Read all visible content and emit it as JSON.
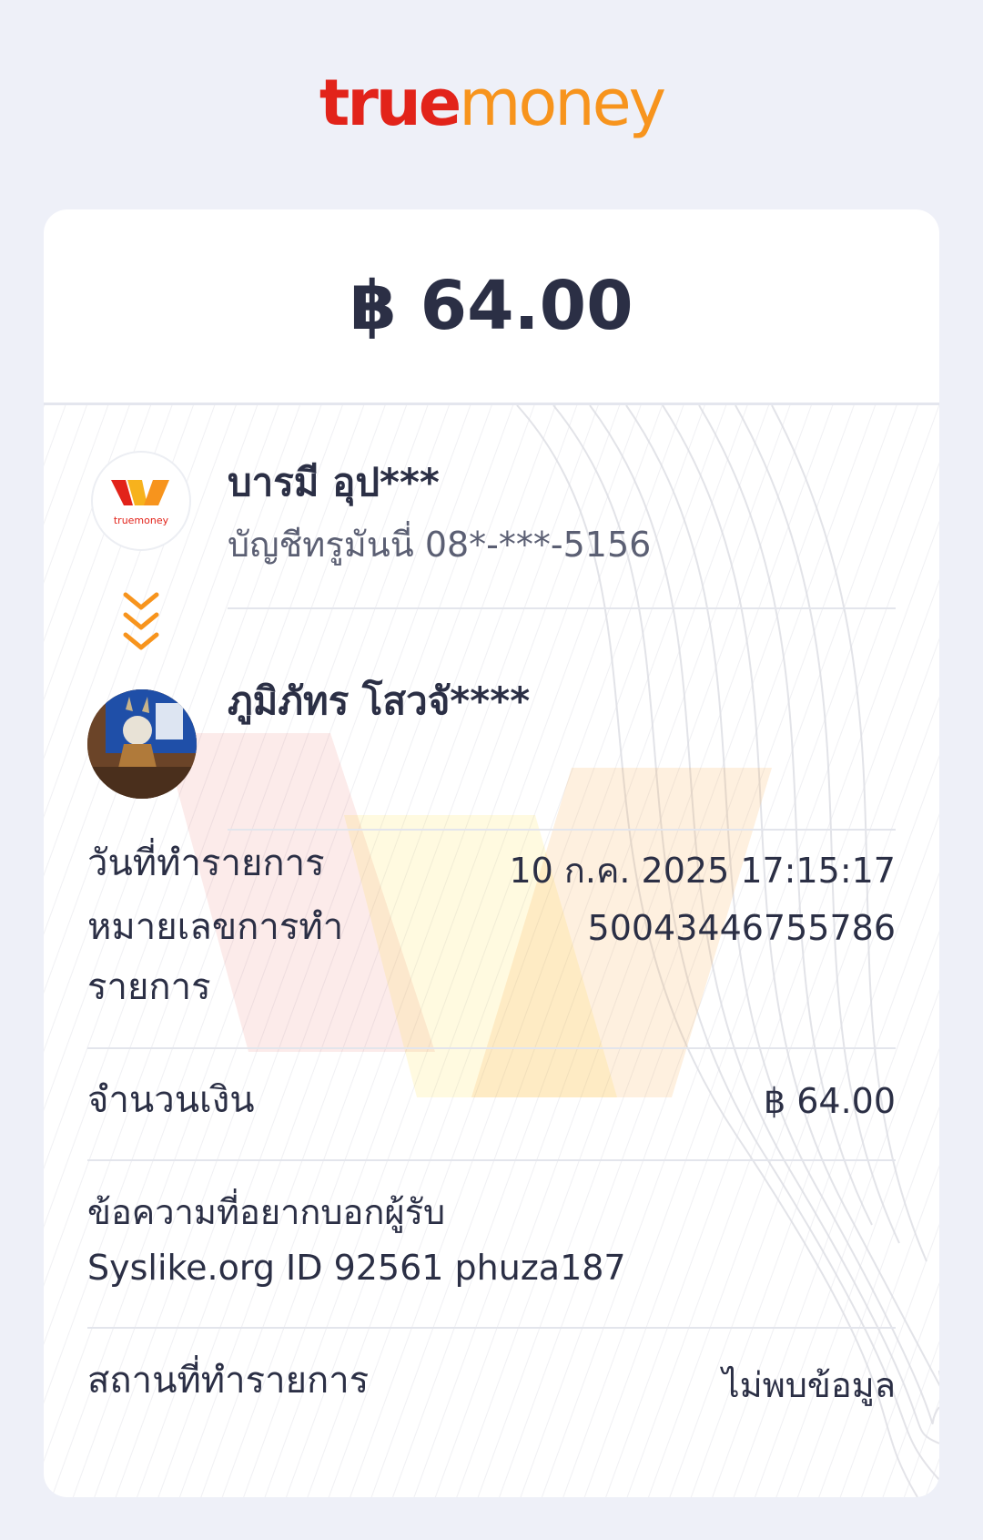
{
  "brand": {
    "part1": "true",
    "part2": "money",
    "icon_caption": "truemoney"
  },
  "amount_header": "฿ 64.00",
  "sender": {
    "name": "บารมี อุป***",
    "account": "บัญชีทรูมันนี่ 08*-***-5156"
  },
  "recipient": {
    "name": "ภูมิภัทร โสวจั****"
  },
  "details": {
    "date_label": "วันที่ทำรายการ",
    "date_value": "10 ก.ค. 2025 17:15:17",
    "txn_label": "หมายเลขการทำรายการ",
    "txn_value": "50043446755786",
    "amount_label": "จำนวนเงิน",
    "amount_value": "฿ 64.00",
    "message_label": "ข้อความที่อยากบอกผู้รับ",
    "message_value": "Syslike.org ID 92561 phuza187",
    "location_label": "สถานที่ทำรายการ",
    "location_value": "ไม่พบข้อมูล"
  },
  "colors": {
    "brand_red": "#e2231a",
    "brand_orange": "#f7941d",
    "text": "#2b2f45"
  },
  "icons": [
    "truemoney-wallet-icon",
    "chevron-double-down-icon",
    "recipient-avatar"
  ]
}
